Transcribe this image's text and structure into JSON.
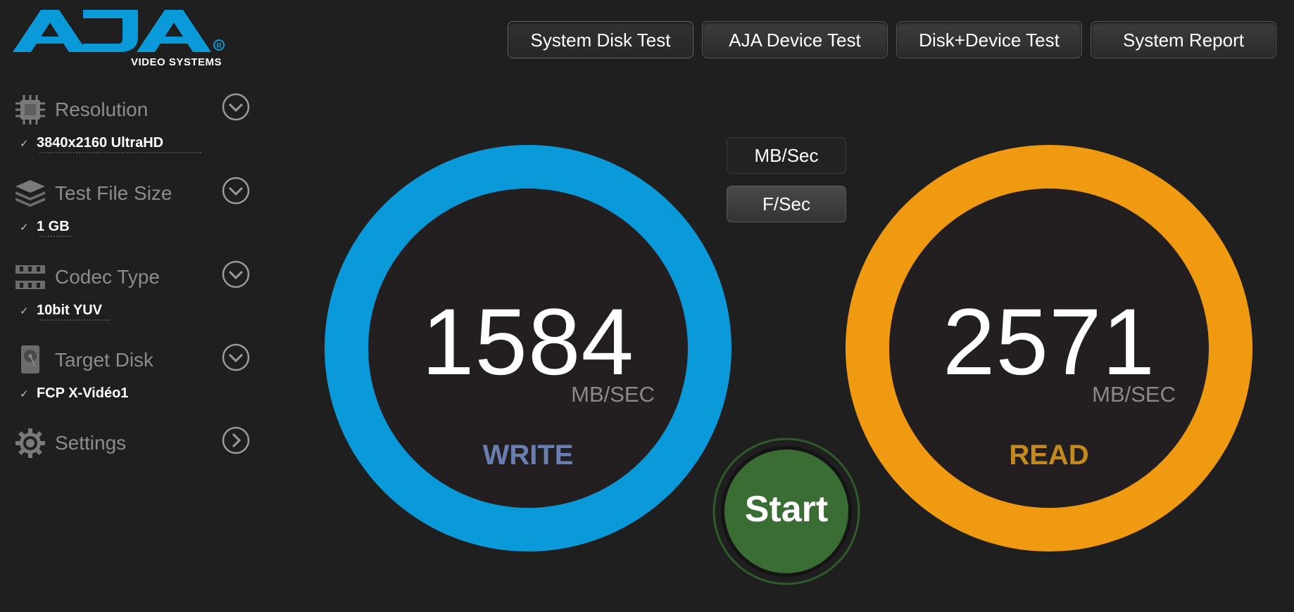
{
  "logo": {
    "brand": "AJA",
    "subtitle": "VIDEO SYSTEMS",
    "brand_color": "#0a9ad9"
  },
  "sidebar": {
    "sections": [
      {
        "title": "Resolution",
        "value": "3840x2160 UltraHD",
        "icon": "chip-icon",
        "control": "chevron-down-icon"
      },
      {
        "title": "Test File Size",
        "value": "1 GB",
        "icon": "layers-icon",
        "control": "chevron-down-icon"
      },
      {
        "title": "Codec Type",
        "value": "10bit YUV",
        "icon": "film-strip-icon",
        "control": "chevron-down-icon"
      },
      {
        "title": "Target Disk",
        "value": "FCP X-Vidéo1",
        "icon": "hard-disk-icon",
        "control": "chevron-down-icon"
      },
      {
        "title": "Settings",
        "value": "",
        "icon": "gear-icon",
        "control": "chevron-right-icon"
      }
    ],
    "check_mark": "✓"
  },
  "tabs": [
    {
      "label": "System Disk Test",
      "active": true
    },
    {
      "label": "AJA Device Test",
      "active": false
    },
    {
      "label": "Disk+Device Test",
      "active": false
    },
    {
      "label": "System Report",
      "active": false
    }
  ],
  "units": {
    "mbsec_label": "MB/Sec",
    "fsec_label": "F/Sec"
  },
  "write": {
    "value": "1584",
    "unit": "MB/SEC",
    "label": "WRITE",
    "ring_color": "#0a9ad9"
  },
  "read": {
    "value": "2571",
    "unit": "MB/SEC",
    "label": "READ",
    "ring_color": "#ef9a10"
  },
  "start": {
    "label": "Start",
    "color": "#3a6d33"
  }
}
